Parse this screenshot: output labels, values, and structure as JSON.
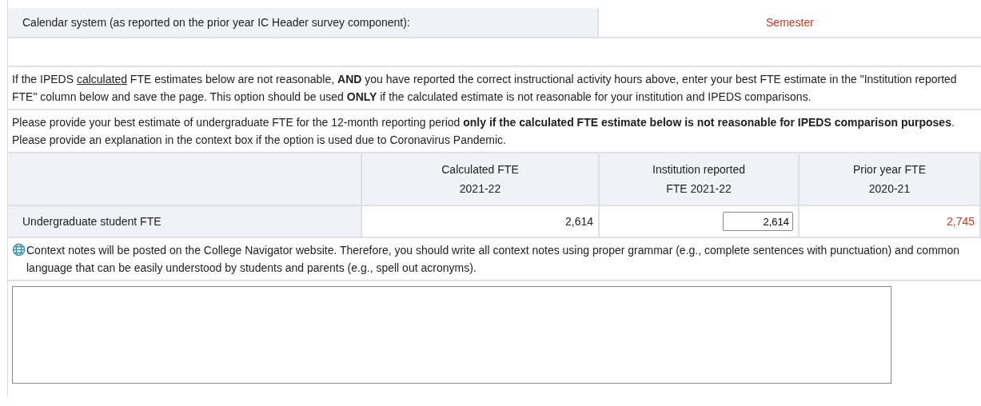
{
  "calendar": {
    "label": "Calendar system (as reported on the prior year IC Header survey component):",
    "value": "Semester"
  },
  "instructions": [
    {
      "before": "If the IPEDS ",
      "underlined": "calculated",
      "after": " FTE estimates below are not reasonable, **AND** you have reported the correct instructional activity hours above, enter your best FTE estimate in the \"Institution reported FTE\" column below and save the page. This option should be used **ONLY** if the calculated estimate is not reasonable for your institution and IPEDS comparisons."
    },
    {
      "before": "Please provide your best estimate of undergraduate FTE for the 12-month reporting period **only if the calculated FTE estimate below is not reasonable for IPEDS comparison purposes**. Please provide an explanation in the context box if the option is used due to Coronavirus Pandemic."
    }
  ],
  "table": {
    "columns": [
      {
        "line1": "Calculated FTE",
        "line2": "2021-22"
      },
      {
        "line1": "Institution reported",
        "line2": "FTE 2021-22"
      },
      {
        "line1": "Prior year FTE",
        "line2": "2020-21"
      }
    ],
    "rows": [
      {
        "label": "Undergraduate student FTE",
        "calculated": "2,614",
        "reported": "2,614",
        "prior_year": "2,745"
      }
    ]
  },
  "context_note": "Context notes will be posted on the College Navigator website. Therefore, you should write all context notes using proper grammar (e.g., complete sentences with punctuation) and common language that can be easily understood by students and parents (e.g., spell out acronyms)."
}
